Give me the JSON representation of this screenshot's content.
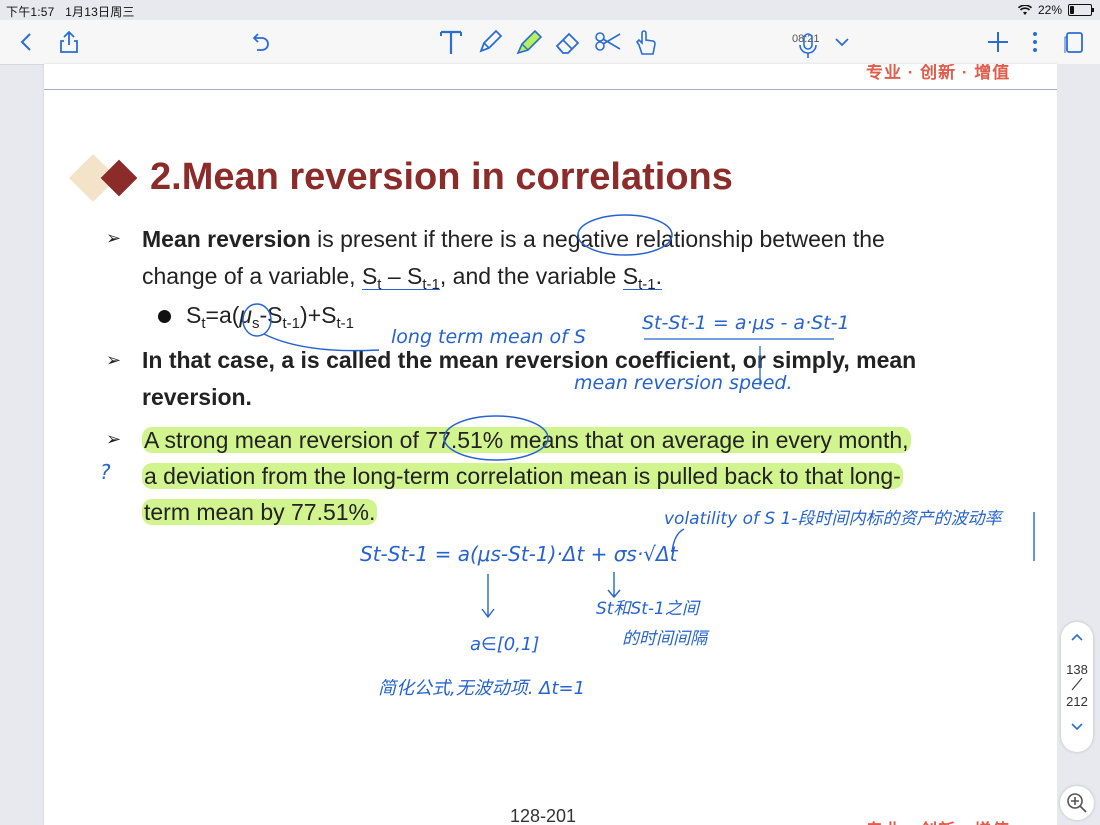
{
  "status_bar": {
    "time": "下午1:57",
    "date": "1月13日周三",
    "battery": "22%",
    "battery_level": 0.22
  },
  "toolbar": {
    "recording_time": "08:21",
    "icons": [
      "back-icon",
      "share-icon",
      "undo-icon",
      "text-tool-icon",
      "pen-icon",
      "highlighter-icon",
      "eraser-icon",
      "lasso-icon",
      "finger-icon",
      "microphone-icon",
      "chevron-down-icon",
      "add-icon",
      "more-icon",
      "pages-icon"
    ]
  },
  "slide": {
    "slogan": "专业 · 创新 · 增值",
    "title": "2.Mean reversion in correlations",
    "bullet1": {
      "bold": "Mean reversion",
      "text_a": " is present if there is a ",
      "negative": "negative",
      "text_b": " relationship between the",
      "line2_a": "change of a variable, ",
      "st": "S",
      "st_sub": "t",
      "minus": " – S",
      "st1_sub": "t-1",
      "line2_b": ", and the variable ",
      "s2": "S",
      "s2_sub": "t-1",
      "period": "."
    },
    "formula": {
      "s": "S",
      "t_sub": "t",
      "eq": "=a(",
      "mu": "μ",
      "mu_sub": "s",
      "mid": "-S",
      "mid_sub": "t-1",
      "end": ")+S",
      "end_sub": "t-1"
    },
    "bullet2": {
      "line1": "In that case, a is called the mean reversion coefficient, or simply, mean",
      "line2": "reversion."
    },
    "bullet3": {
      "line1": "A strong mean reversion of 77.51% means that on average in every month,",
      "line2": "a deviation from the long-term correlation mean is pulled back to that long-",
      "line3": "term mean by 77.51%."
    },
    "page_label": "128-201"
  },
  "annotations": {
    "long_term": "long term mean of S",
    "eq_right": "St-St-1 = a·μs - a·St-1",
    "mean_speed": "mean reversion speed.",
    "volatility": "volatility of S  1-段时间内标的资产的波动率",
    "main_eq": "St-St-1 = a(μs-St-1)·Δt + σs·√Δt",
    "interval": "St和St-1之间",
    "interval2": "的时间间隔",
    "a_range": "a∈[0,1]",
    "simplify": "简化公式,无波动项. Δt=1",
    "question": "?"
  },
  "scroller": {
    "current": "138",
    "total": "212"
  }
}
